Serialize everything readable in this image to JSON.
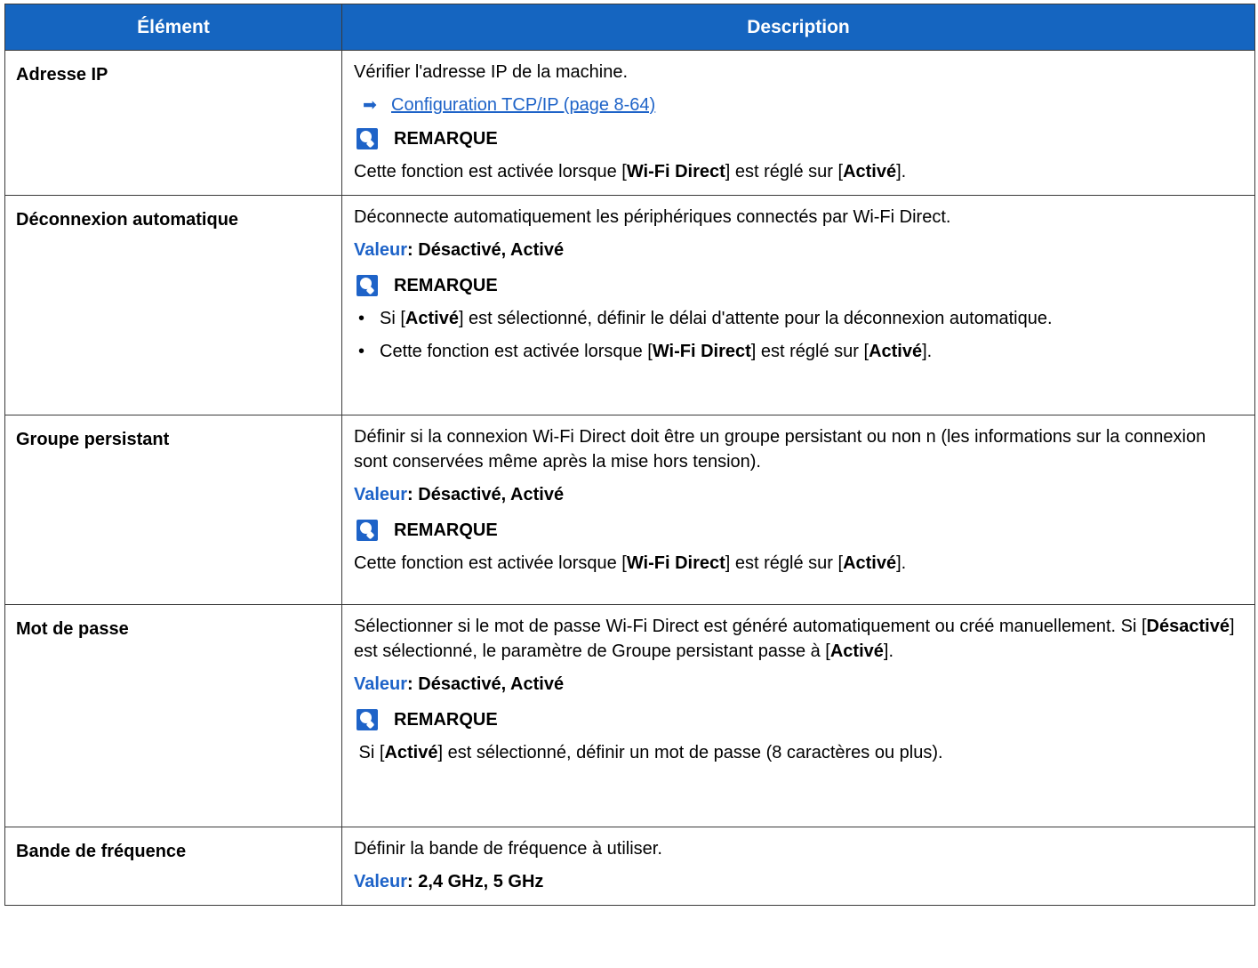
{
  "header": {
    "col1": "Élément",
    "col2": "Description"
  },
  "note_label": "REMARQUE",
  "value_label": "Valeur",
  "rows": [
    {
      "item": "Adresse IP",
      "desc": "Vérifier l'adresse IP de la machine.",
      "link": "Configuration TCP/IP (page 8-64)",
      "note": [
        "Cette fonction est activée lorsque [",
        "Wi-Fi Direct",
        "] est réglé sur [",
        "Activé",
        "]."
      ]
    },
    {
      "item": "Déconnexion automatique",
      "desc": "Déconnecte automatiquement les périphériques connectés par Wi-Fi Direct.",
      "value": ": Désactivé, Activé",
      "bullets": [
        [
          "Si [",
          "Activé",
          "] est sélectionné, définir le délai d'attente pour la déconnexion automatique."
        ],
        [
          "Cette fonction est activée lorsque [",
          "Wi-Fi Direct",
          "] est réglé sur [",
          "Activé",
          "]."
        ]
      ]
    },
    {
      "item": "Groupe persistant",
      "desc": "Définir si la connexion Wi-Fi Direct doit être un groupe persistant ou non n (les informations sur la connexion sont conservées même après la mise hors tension).",
      "value": ": Désactivé, Activé",
      "note": [
        "Cette fonction est activée lorsque [",
        "Wi-Fi Direct",
        "] est réglé sur [",
        "Activé",
        "]."
      ]
    },
    {
      "item": "Mot de passe",
      "desc": [
        "Sélectionner si le mot de passe Wi-Fi Direct est généré automatiquement ou créé manuellement. Si [",
        "Désactivé",
        "] est sélectionné, le paramètre de Groupe persistant passe à [",
        "Activé",
        "]."
      ],
      "value": ": Désactivé, Activé",
      "note": [
        " Si [",
        "Activé",
        "] est sélectionné, définir un mot de passe (8 caractères ou plus)."
      ]
    },
    {
      "item": "Bande de fréquence",
      "desc": "Définir la bande de fréquence à utiliser.",
      "value": ": 2,4 GHz, 5 GHz"
    }
  ]
}
